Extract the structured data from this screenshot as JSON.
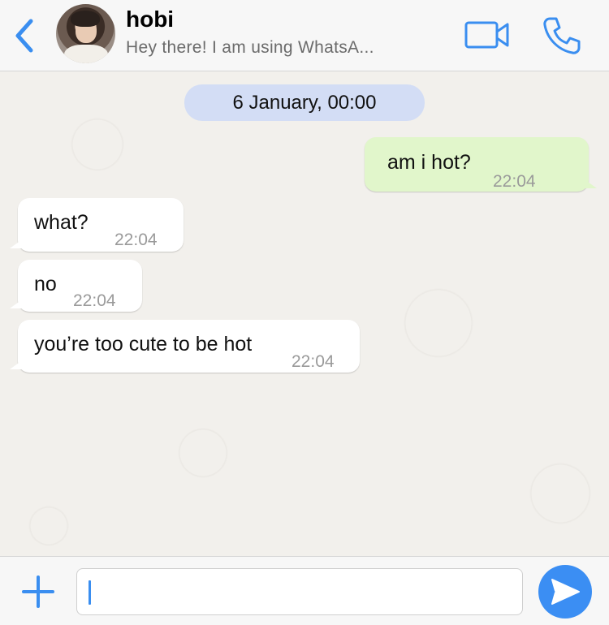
{
  "header": {
    "contact_name": "hobi",
    "contact_status": "Hey there! I am using WhatsA...",
    "accent_color": "#3a8ef0"
  },
  "chat": {
    "date_divider": "6 January, 00:00",
    "messages": [
      {
        "direction": "outgoing",
        "text": "am i hot?",
        "time": "22:04"
      },
      {
        "direction": "incoming",
        "text": "what?",
        "time": "22:04"
      },
      {
        "direction": "incoming",
        "text": "no",
        "time": "22:04"
      },
      {
        "direction": "incoming",
        "text": "you’re too cute to be hot",
        "time": "22:04"
      }
    ]
  },
  "composer": {
    "input_value": "",
    "placeholder": ""
  },
  "icons": {
    "back": "chevron-left-icon",
    "video": "video-camera-icon",
    "call": "phone-icon",
    "add": "plus-icon",
    "send": "send-icon"
  },
  "colors": {
    "outgoing_bubble": "#e1f6cb",
    "incoming_bubble": "#ffffff",
    "date_pill": "#d3ddf5",
    "send_button": "#3b8ef3"
  }
}
